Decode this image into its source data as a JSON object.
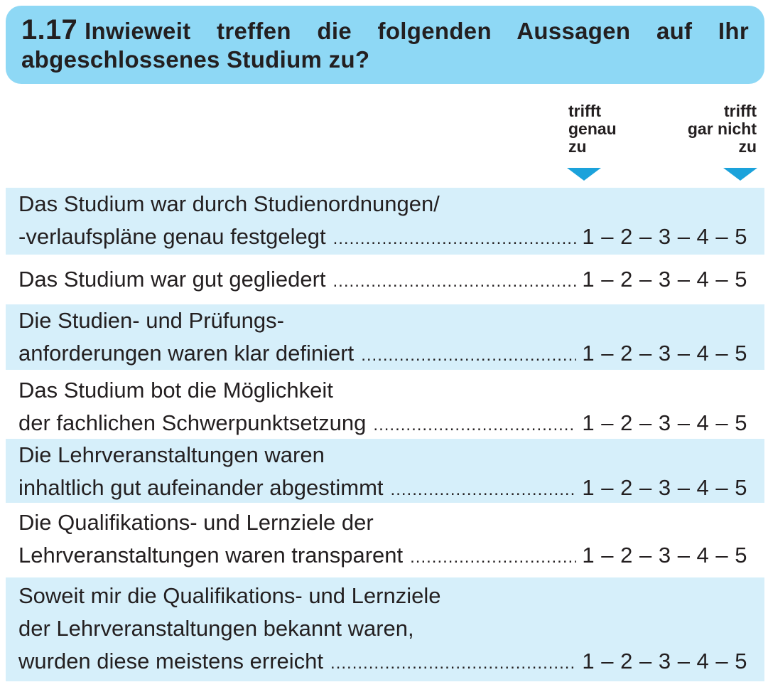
{
  "question": {
    "number": "1.17",
    "text": "Inwieweit treffen die folgenden Aussagen auf Ihr abgeschlossenes Studium zu?"
  },
  "scale": {
    "left": [
      "trifft",
      "genau",
      "zu"
    ],
    "right": [
      "trifft",
      "gar nicht",
      "zu"
    ],
    "values": "1 – 2 – 3 – 4 – 5"
  },
  "items": [
    {
      "lines": [
        "Das Studium war durch Studienordnungen/",
        "-verlaufspläne genau festgelegt"
      ]
    },
    {
      "lines": [
        "Das Studium war gut gegliedert"
      ]
    },
    {
      "lines": [
        "Die Studien- und Prüfungs-",
        "anforderungen waren klar definiert"
      ]
    },
    {
      "lines": [
        "Das Studium bot die Möglichkeit",
        "der fachlichen Schwerpunktsetzung"
      ]
    },
    {
      "lines": [
        "Die Lehrveranstaltungen waren",
        "inhaltlich gut aufeinander abgestimmt"
      ]
    },
    {
      "lines": [
        "Die Qualifikations- und Lernziele der",
        "Lehrveranstaltungen waren transparent"
      ]
    },
    {
      "lines": [
        "Soweit mir die Qualifikations- und Lernziele",
        "der Lehrveranstaltungen bekannt waren,",
        "wurden diese meistens erreicht"
      ]
    }
  ]
}
